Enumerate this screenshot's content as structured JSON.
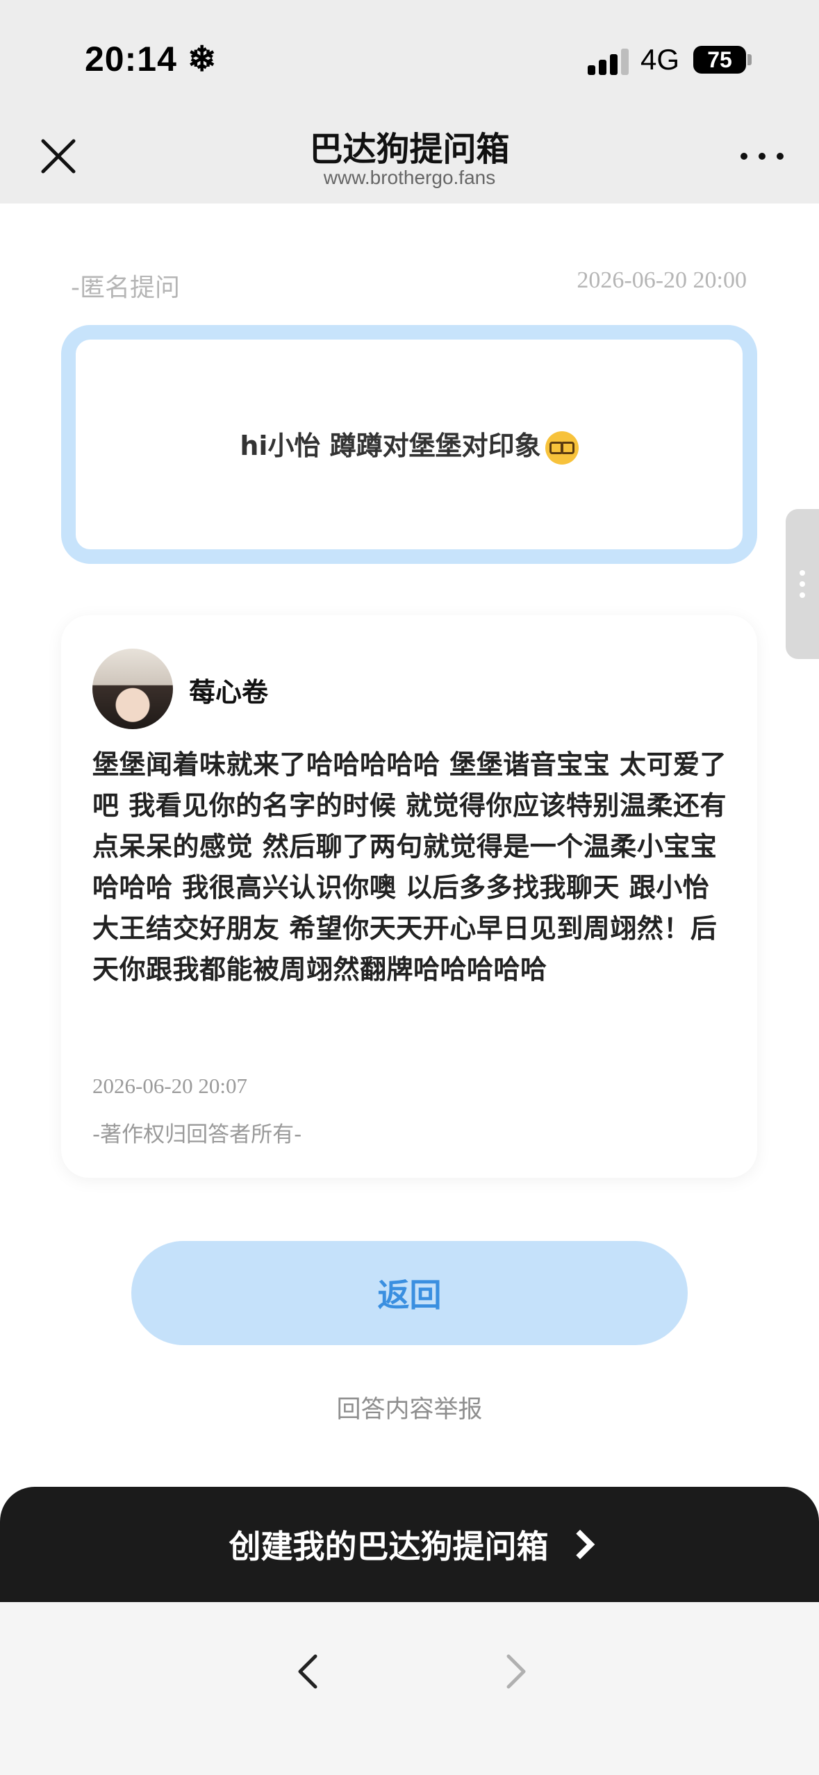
{
  "status_bar": {
    "time": "20:14",
    "weather_icon": "snowflake-icon",
    "network": "4G",
    "battery": "75"
  },
  "header": {
    "title": "巴达狗提问箱",
    "subtitle": "www.brothergo.fans"
  },
  "question": {
    "author": "-匿名提问",
    "time": "2026-06-20 20:00",
    "text": "hi小怡 蹲蹲对堡堡对印象",
    "emoji": "nerd-face"
  },
  "answer": {
    "name": "莓心卷",
    "text": "堡堡闻着味就来了哈哈哈哈哈 堡堡谐音宝宝 太可爱了吧 我看见你的名字的时候 就觉得你应该特别温柔还有点呆呆的感觉 然后聊了两句就觉得是一个温柔小宝宝哈哈哈 我很高兴认识你噢 以后多多找我聊天 跟小怡大王结交好朋友 希望你天天开心早日见到周翊然！后天你跟我都能被周翊然翻牌哈哈哈哈哈",
    "time": "2026-06-20 20:07",
    "copyright": "-著作权归回答者所有-"
  },
  "actions": {
    "back_label": "返回",
    "report_label": "回答内容举报",
    "create_label": "创建我的巴达狗提问箱"
  },
  "colors": {
    "accent_light": "#c5e1fa",
    "accent_text": "#3a8fe0",
    "card_border": "#c7e3fb",
    "bar_dark": "#1b1b1b"
  }
}
